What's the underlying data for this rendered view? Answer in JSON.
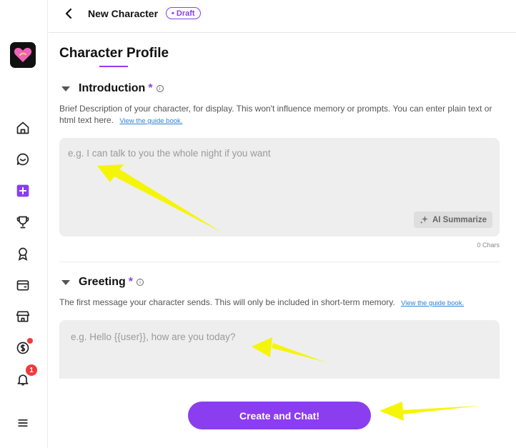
{
  "header": {
    "title": "New Character",
    "draft_badge": "• Draft"
  },
  "sidebar": {
    "items": [
      {
        "icon": "home-icon"
      },
      {
        "icon": "chat-icon"
      },
      {
        "icon": "create-plus-icon"
      },
      {
        "icon": "trophy-icon"
      },
      {
        "icon": "award-icon"
      },
      {
        "icon": "wallet-icon"
      },
      {
        "icon": "store-icon"
      },
      {
        "icon": "coin-icon"
      },
      {
        "icon": "bell-icon",
        "badge": "1"
      },
      {
        "icon": "menu-icon"
      }
    ]
  },
  "main": {
    "section_title": "Character Profile",
    "introduction": {
      "label": "Introduction",
      "required_mark": "*",
      "description": "Brief Description of your character, for display. This won't influence memory or prompts. You can enter plain text or html text here.",
      "guide_link": "View the guide book.",
      "placeholder": "e.g. I can talk to you the whole night if you want",
      "ai_button": "AI Summarize",
      "char_count": "0 Chars"
    },
    "greeting": {
      "label": "Greeting",
      "required_mark": "*",
      "description": "The first message your character sends. This will only be included in short-term memory.",
      "guide_link": "View the guide book.",
      "placeholder": "e.g. Hello {{user}}, how are you today?"
    },
    "cta_label": "Create and Chat!"
  },
  "colors": {
    "accent": "#8b3df0",
    "annotation_arrow": "#f5f50a",
    "badge_red": "#ef3b3b"
  }
}
